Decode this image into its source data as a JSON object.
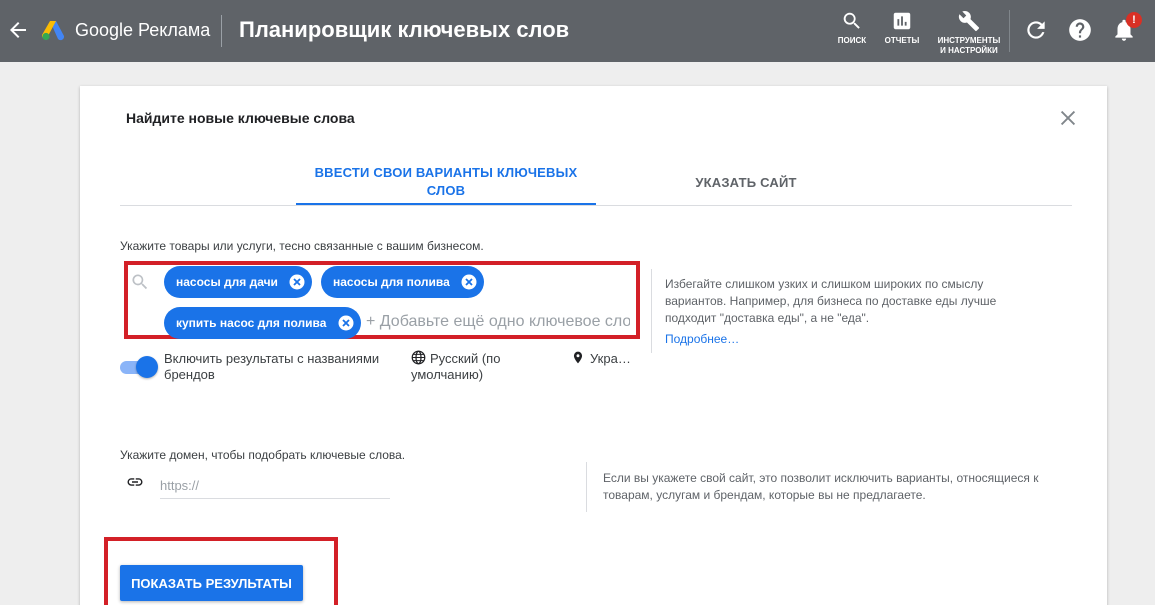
{
  "header": {
    "back_icon": "arrow-back-icon",
    "logo_icon": "google-ads-logo-icon",
    "brand": "Google Реклама",
    "title": "Планировщик ключевых слов",
    "tools": [
      {
        "icon": "search-icon",
        "label": "ПОИСК"
      },
      {
        "icon": "bar-chart-icon",
        "label": "ОТЧЕТЫ"
      },
      {
        "icon": "wrench-icon",
        "label_line1": "ИНСТРУМЕНТЫ",
        "label_line2": "И НАСТРОЙКИ"
      }
    ],
    "refresh_icon": "refresh-icon",
    "help_icon": "help-icon",
    "notifications_icon": "bell-icon",
    "notification_badge": "!"
  },
  "dialog": {
    "title": "Найдите новые ключевые слова",
    "close_icon": "close-icon",
    "tabs": [
      {
        "label": "ВВЕСТИ СВОИ ВАРИАНТЫ КЛЮЧЕВЫХ СЛОВ",
        "active": true
      },
      {
        "label": "УКАЗАТЬ САЙТ",
        "active": false
      }
    ],
    "keywords_section": {
      "prompt": "Укажите товары или услуги, тесно связанные с вашим бизнесом.",
      "chips": [
        "насосы для дачи",
        "насосы для полива",
        "купить насос для полива"
      ],
      "add_placeholder": "+ Добавьте ещё одно ключевое слово",
      "tip": "Избегайте слишком узких и слишком широких по смыслу вариантов. Например, для бизнеса по доставке еды лучше подходит \"доставка еды\", а не \"еда\".",
      "more_link": "Подробнее…",
      "brand_toggle_label": "Включить результаты с названиями брендов",
      "brand_toggle_on": true,
      "language": "Русский (по умолчанию)",
      "location": "Укра…"
    },
    "domain_section": {
      "prompt": "Укажите домен, чтобы подобрать ключевые слова.",
      "url_placeholder": "https://",
      "url_value": "",
      "tip": "Если вы укажете свой сайт, это позволит исключить варианты, относящиеся к товарам, услугам и брендам, которые вы не предлагаете."
    },
    "submit_label": "ПОКАЗАТЬ РЕЗУЛЬТАТЫ"
  },
  "colors": {
    "topbar": "#5f6368",
    "accent": "#1a73e8",
    "highlight": "#d32027"
  }
}
